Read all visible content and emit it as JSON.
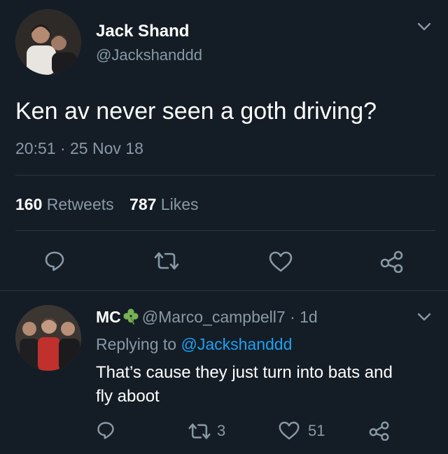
{
  "tweet": {
    "display_name": "Jack Shand",
    "handle": "@Jackshanddd",
    "text": "Ken av never seen a goth driving?",
    "time": "20:51",
    "dot": "·",
    "date": "25 Nov 18",
    "retweets_count": "160",
    "retweets_label": "Retweets",
    "likes_count": "787",
    "likes_label": "Likes",
    "actions": [
      "reply-icon",
      "retweet-icon",
      "like-icon",
      "share-icon"
    ]
  },
  "reply": {
    "display_name": "MC",
    "emoji_name": "shamrock-icon",
    "handle": "@Marco_campbell7",
    "age": "· 1d",
    "replying_prefix": "Replying to",
    "replying_handle": "@Jackshanddd",
    "text_line1": "That’s cause they just turn into bats and",
    "text_line2": "fly aboot",
    "retweet_count": "3",
    "like_count": "51"
  },
  "colors": {
    "background": "#141d26",
    "muted": "#8899a6",
    "link": "#1da1f2",
    "shamrock": "#77b255"
  }
}
